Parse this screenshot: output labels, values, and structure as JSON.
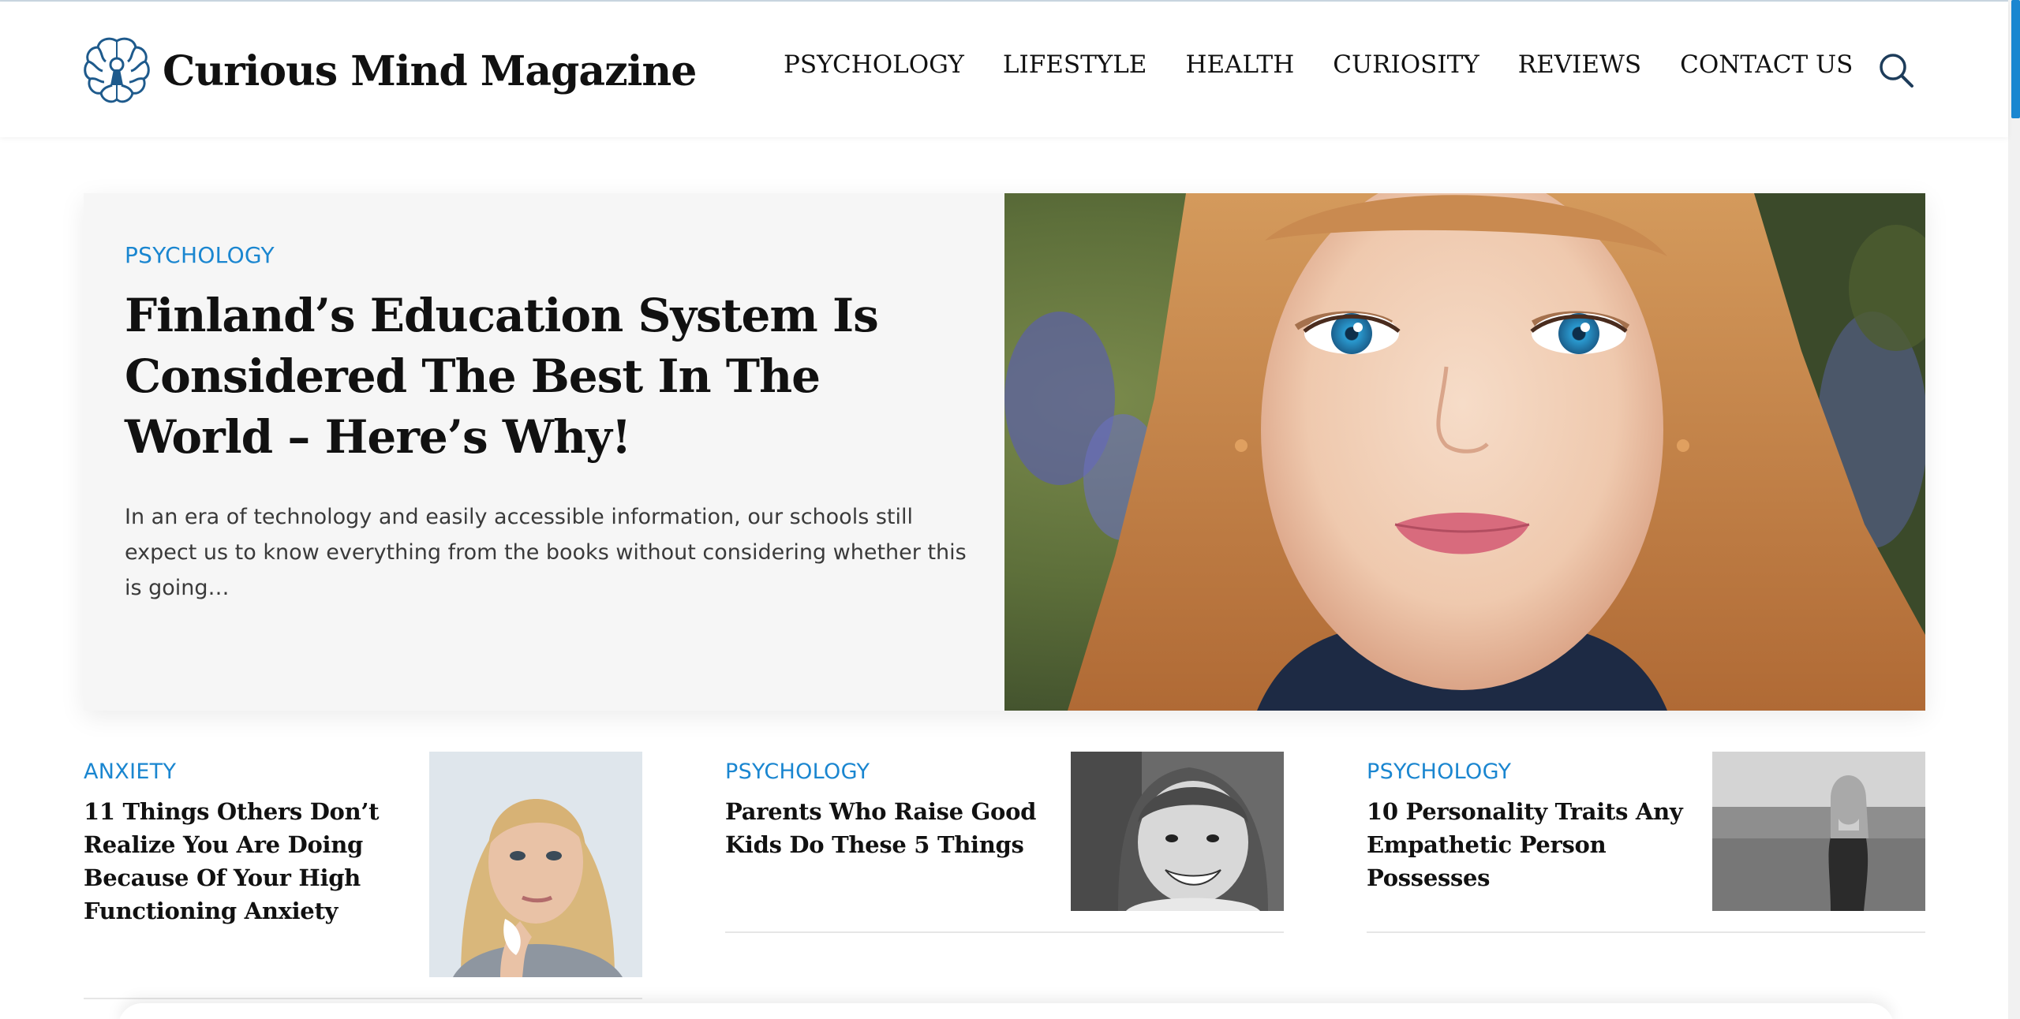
{
  "site": {
    "name": "Curious Mind Magazine",
    "logo_icon": "brain-keyhole-icon",
    "accent_color": "#1a86d0"
  },
  "nav": {
    "items": [
      {
        "label": "PSYCHOLOGY"
      },
      {
        "label": "LIFESTYLE"
      },
      {
        "label": "HEALTH"
      },
      {
        "label": "CURIOSITY"
      },
      {
        "label": "REVIEWS"
      },
      {
        "label": "CONTACT US"
      }
    ],
    "search_icon": "search-icon"
  },
  "hero": {
    "category": "PSYCHOLOGY",
    "title": "Finland’s Education System Is Considered The Best In The World – Here’s Why!",
    "excerpt": "In an era of technology and easily accessible information, our schools still expect us to know everything from the books without considering whether this is going…",
    "image": "portrait of a girl with blue eyes and strawberry-blonde hair"
  },
  "cards": [
    {
      "category": "ANXIETY",
      "title": "11 Things Others Don’t Realize You Are Doing Because Of Your High Functioning Anxiety",
      "image": "woman with blonde bob holding a white feather"
    },
    {
      "category": "PSYCHOLOGY",
      "title": "Parents Who Raise Good Kids Do These 5 Things",
      "image": "black and white photo of smiling little girl"
    },
    {
      "category": "PSYCHOLOGY",
      "title": "10 Personality Traits Any Empathetic Person Possesses",
      "image": "black and white photo of woman in a field"
    }
  ]
}
